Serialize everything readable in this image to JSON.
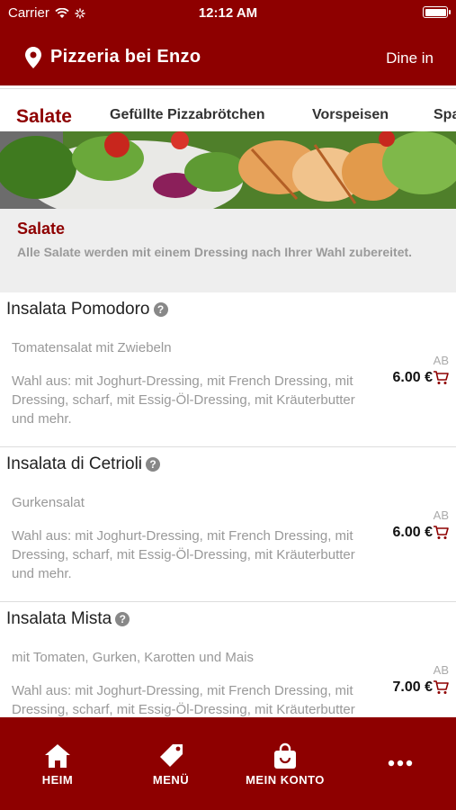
{
  "status": {
    "carrier": "Carrier",
    "time": "12:12 AM"
  },
  "header": {
    "restaurant": "Pizzeria bei Enzo",
    "mode": "Dine in",
    "location_icon": "map-pin-icon"
  },
  "tabs": [
    {
      "label": "Salate",
      "active": true
    },
    {
      "label": "Gefüllte Pizzabrötchen",
      "active": false
    },
    {
      "label": "Vorspeisen",
      "active": false
    },
    {
      "label": "Spa",
      "active": false
    }
  ],
  "category": {
    "title": "Salate",
    "description": "Alle Salate werden mit einem Dressing nach Ihrer Wahl zubereitet."
  },
  "items": [
    {
      "name": "Insalata Pomodoro",
      "subtitle": "Tomatensalat mit Zwiebeln",
      "options": "Wahl aus: mit Joghurt-Dressing, mit French Dressing, mit Dressing, scharf, mit Essig-Öl-Dressing, mit Kräuterbutter und mehr.",
      "price_prefix": "AB",
      "price": "6.00 €"
    },
    {
      "name": "Insalata di Cetrioli",
      "subtitle": "Gurkensalat",
      "options": "Wahl aus: mit Joghurt-Dressing, mit French Dressing, mit Dressing, scharf, mit Essig-Öl-Dressing, mit Kräuterbutter und mehr.",
      "price_prefix": "AB",
      "price": "6.00 €"
    },
    {
      "name": "Insalata Mista",
      "subtitle": "mit Tomaten, Gurken, Karotten und Mais",
      "options": "Wahl aus: mit Joghurt-Dressing, mit French Dressing, mit Dressing, scharf, mit Essig-Öl-Dressing, mit Kräuterbutter und mehr.",
      "price_prefix": "AB",
      "price": "7.00 €"
    }
  ],
  "bottom_nav": [
    {
      "label": "HEIM",
      "icon": "home-icon"
    },
    {
      "label": "MENÜ",
      "icon": "tag-icon"
    },
    {
      "label": "MEIN KONTO",
      "icon": "shopping-bag-icon"
    },
    {
      "label": "",
      "icon": "more-icon"
    }
  ],
  "colors": {
    "brand": "#8e0000",
    "muted": "#999999",
    "band": "#eeeeee"
  }
}
